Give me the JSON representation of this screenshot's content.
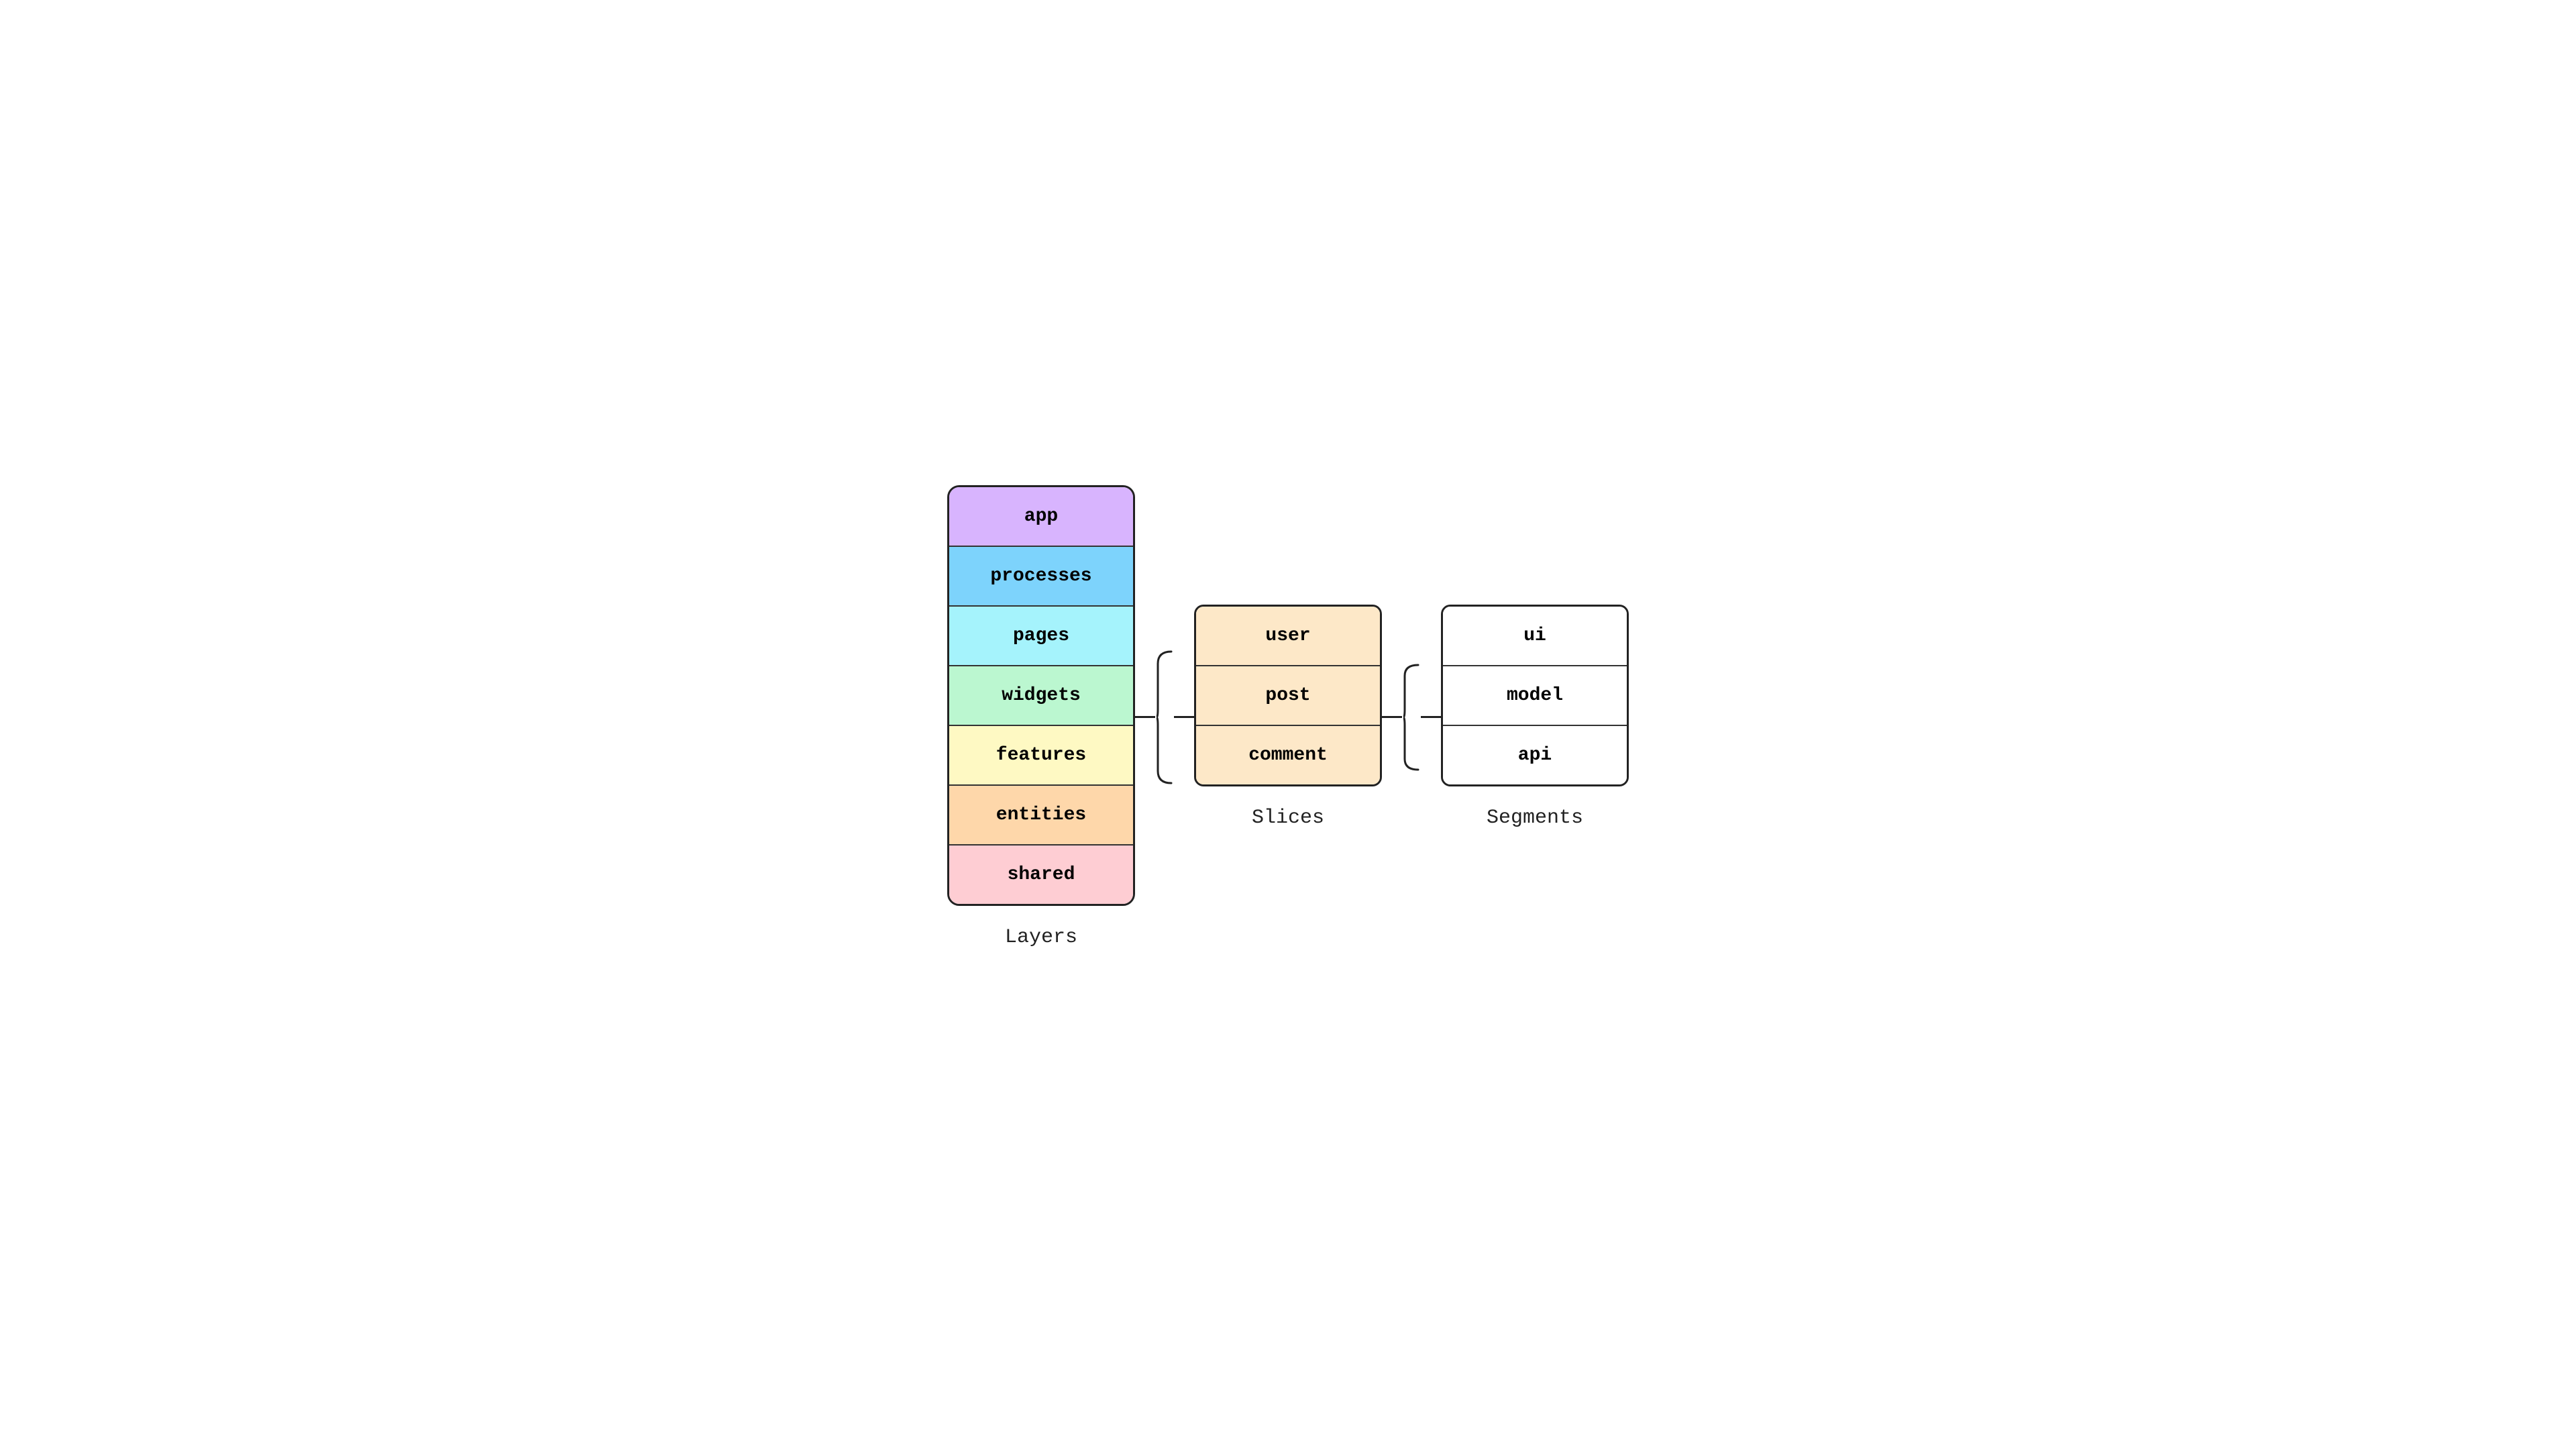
{
  "layers": {
    "label": "Layers",
    "items": [
      {
        "id": "app",
        "label": "app",
        "colorClass": "layer-app"
      },
      {
        "id": "processes",
        "label": "processes",
        "colorClass": "layer-processes"
      },
      {
        "id": "pages",
        "label": "pages",
        "colorClass": "layer-pages"
      },
      {
        "id": "widgets",
        "label": "widgets",
        "colorClass": "layer-widgets"
      },
      {
        "id": "features",
        "label": "features",
        "colorClass": "layer-features"
      },
      {
        "id": "entities",
        "label": "entities",
        "colorClass": "layer-entities"
      },
      {
        "id": "shared",
        "label": "shared",
        "colorClass": "layer-shared"
      }
    ]
  },
  "slices": {
    "label": "Slices",
    "items": [
      {
        "id": "user",
        "label": "user"
      },
      {
        "id": "post",
        "label": "post"
      },
      {
        "id": "comment",
        "label": "comment"
      }
    ]
  },
  "segments": {
    "label": "Segments",
    "items": [
      {
        "id": "ui",
        "label": "ui"
      },
      {
        "id": "model",
        "label": "model"
      },
      {
        "id": "api",
        "label": "api"
      }
    ]
  },
  "connector1": {
    "lineColor": "#222222"
  },
  "connector2": {
    "lineColor": "#222222"
  }
}
